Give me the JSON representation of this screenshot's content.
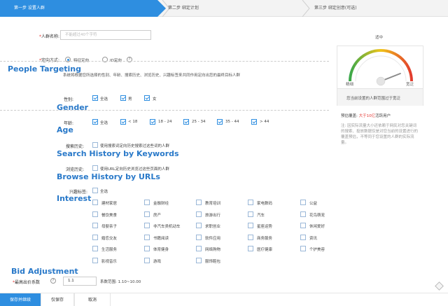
{
  "steps": [
    {
      "label": "第一步 设置人群"
    },
    {
      "label": "第二步 绑定计划"
    },
    {
      "label": "第三步 绑定创意(可选)"
    }
  ],
  "name_field": {
    "label": "人群名称:",
    "placeholder": "不能超过40个字符"
  },
  "targeting": {
    "label": "定向方式:",
    "option_feature": "特征定向",
    "option_id": "ID定向",
    "description": "系统将根据您所选择的性别、年龄、搜索历史、浏览历史、兴趣标签来共同作用定向出您的最终目标人群"
  },
  "gender": {
    "label": "性别:",
    "options": [
      "全选",
      "男",
      "女"
    ]
  },
  "age": {
    "label": "年龄:",
    "options": [
      "全选",
      "< 18",
      "18 - 24",
      "25 - 34",
      "35 - 44",
      "> 44"
    ]
  },
  "search_history": {
    "label": "搜索历史:",
    "option": "使用搜索词定向历史搜索过这些词的人群"
  },
  "browse_history": {
    "label": "浏览历史:",
    "option": "使用URL定向历史浏览过这些页面的人群"
  },
  "interest": {
    "label": "兴趣标签:",
    "select_all": "全选",
    "tags": [
      "建材家居",
      "金融财经",
      "教育培训",
      "家电数码",
      "公益",
      "餐饮美食",
      "房产",
      "旅游出行",
      "汽车",
      "花鸟萌宠",
      "母婴亲子",
      "非汽车类机动车",
      "求职创业",
      "星座运势",
      "休闲爱好",
      "婚恋交友",
      "书籍阅读",
      "软件应用",
      "商务服务",
      "资讯",
      "生活服务",
      "体育健身",
      "网络购物",
      "医疗健康",
      "个护美容",
      "影视音乐",
      "游戏",
      "服饰鞋包"
    ]
  },
  "bid": {
    "label": "最高出价系数",
    "value": "1.1",
    "range": "系数范围: 1.10~10.00"
  },
  "gauge": {
    "top_label": "适中",
    "left_label": "精细",
    "right_label": "宽泛",
    "caption": "您当前设置的人群范围过于宽泛",
    "needle_fraction": 0.88
  },
  "coverage": {
    "label": "预估覆盖:",
    "value": "大于10亿",
    "suffix": "活跃用户"
  },
  "note": "注: 因实际流量大小还依赖于网民对您关键词的搜索、投放数据仅是对您当前的设置进行的覆盖预估，不等同于您设置的人群的实际流量。",
  "annotations": {
    "people_targeting": "People Targeting",
    "gender": "Gender",
    "age": "Age",
    "search": "Search History by Keywords",
    "browse": "Browse History by URLs",
    "interest": "Interest",
    "bid": "Bid Adjustment"
  },
  "buttons": {
    "save_continue": "保存并继续",
    "save_only": "仅保存",
    "cancel": "取消"
  },
  "colors": {
    "accent": "#2e8ee0",
    "annotation": "#2979c9",
    "warning": "#e53935"
  }
}
